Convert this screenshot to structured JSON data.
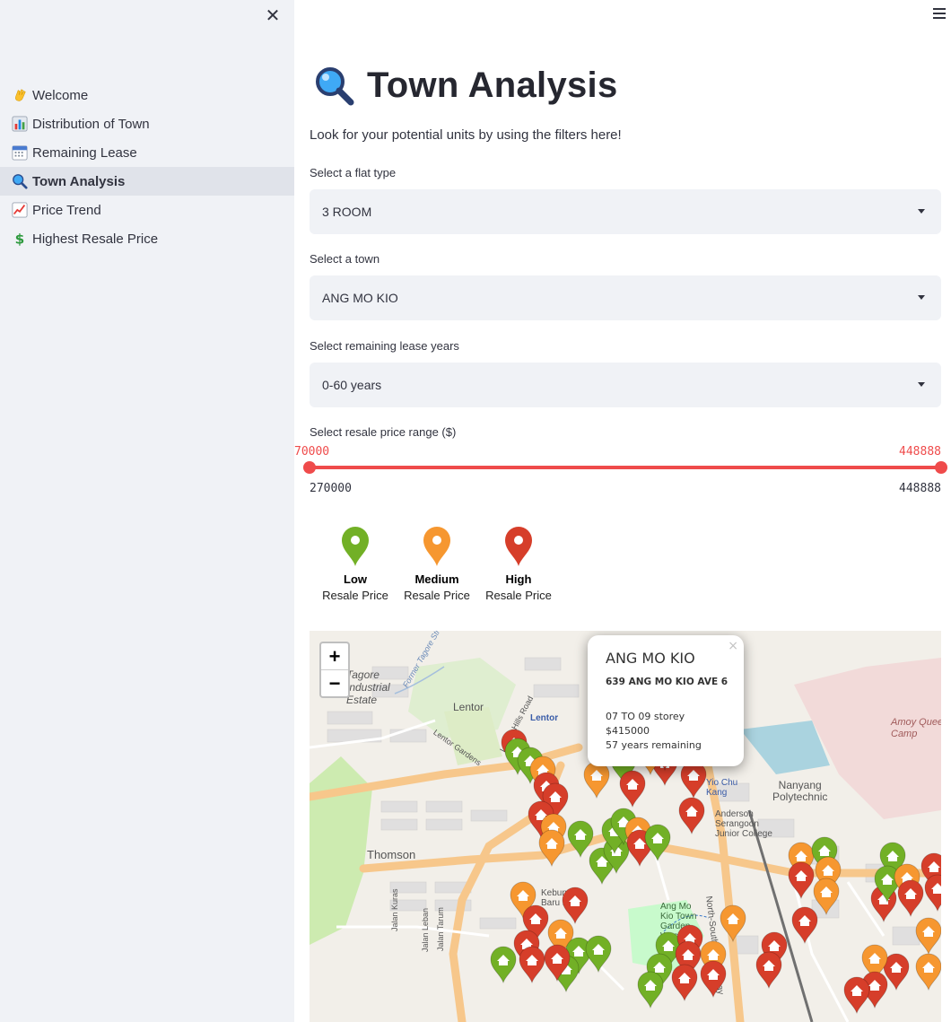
{
  "sidebar": {
    "items": [
      {
        "label": "Welcome",
        "icon": "waving-hand-icon"
      },
      {
        "label": "Distribution of Town",
        "icon": "bar-chart-icon"
      },
      {
        "label": "Remaining Lease",
        "icon": "calendar-icon"
      },
      {
        "label": "Town Analysis",
        "icon": "magnifier-icon",
        "active": true
      },
      {
        "label": "Price Trend",
        "icon": "trend-chart-icon"
      },
      {
        "label": "Highest Resale Price",
        "icon": "dollar-icon"
      }
    ]
  },
  "page": {
    "title": "Town Analysis",
    "subtitle": "Look for your potential units by using the filters here!"
  },
  "filters": {
    "flat_type": {
      "label": "Select a flat type",
      "value": "3 ROOM"
    },
    "town": {
      "label": "Select a town",
      "value": "ANG MO KIO"
    },
    "lease": {
      "label": "Select remaining lease years",
      "value": "0-60 years"
    },
    "price": {
      "label": "Select resale price range ($)",
      "low_value_display": "70000",
      "high_value_display": "448888",
      "min_label": "270000",
      "max_label": "448888",
      "low_fraction": 0.0,
      "high_fraction": 1.0
    }
  },
  "legend": [
    {
      "bold": "Low",
      "sub": "Resale Price",
      "color": "#72b026"
    },
    {
      "bold": "Medium",
      "sub": "Resale Price",
      "color": "#f69730"
    },
    {
      "bold": "High",
      "sub": "Resale Price",
      "color": "#d63e2a"
    }
  ],
  "map": {
    "zoom_in": "+",
    "zoom_out": "−",
    "popup": {
      "close": "×",
      "town": "ANG MO KIO",
      "address": "639 ANG MO KIO AVE 6",
      "storey": "07 TO 09 storey",
      "price": "$415000",
      "remaining": "57 years remaining"
    },
    "labels": {
      "tagore": "Tagore\nIndustrial\nEstate",
      "lentor": "Lentor",
      "lentor_station": "Lentor",
      "thomson": "Thomson",
      "nanyang": "Nanyang\nPolytechnic",
      "amoy": "Amoy Quee\nCamp",
      "yio_chu_kang": "Yio Chu\nKang",
      "anderson": "Anderson\nSerangoon\nJunior College",
      "kebun": "Kebun\nBaru Link",
      "town_garden": "Ang Mo\nKio Town\nGarden\nWest",
      "former_tagore": "Former Tagore Stream",
      "lentor_gardens": "Lentor Gardens",
      "lentor_hills": "Lentor Hills Road",
      "nsex": "North-South Expressway",
      "jalan_kuras": "Jalan Kuras",
      "jalan_leban": "Jalan Leban",
      "jalan_tarum": "Jalan Tarum"
    }
  }
}
